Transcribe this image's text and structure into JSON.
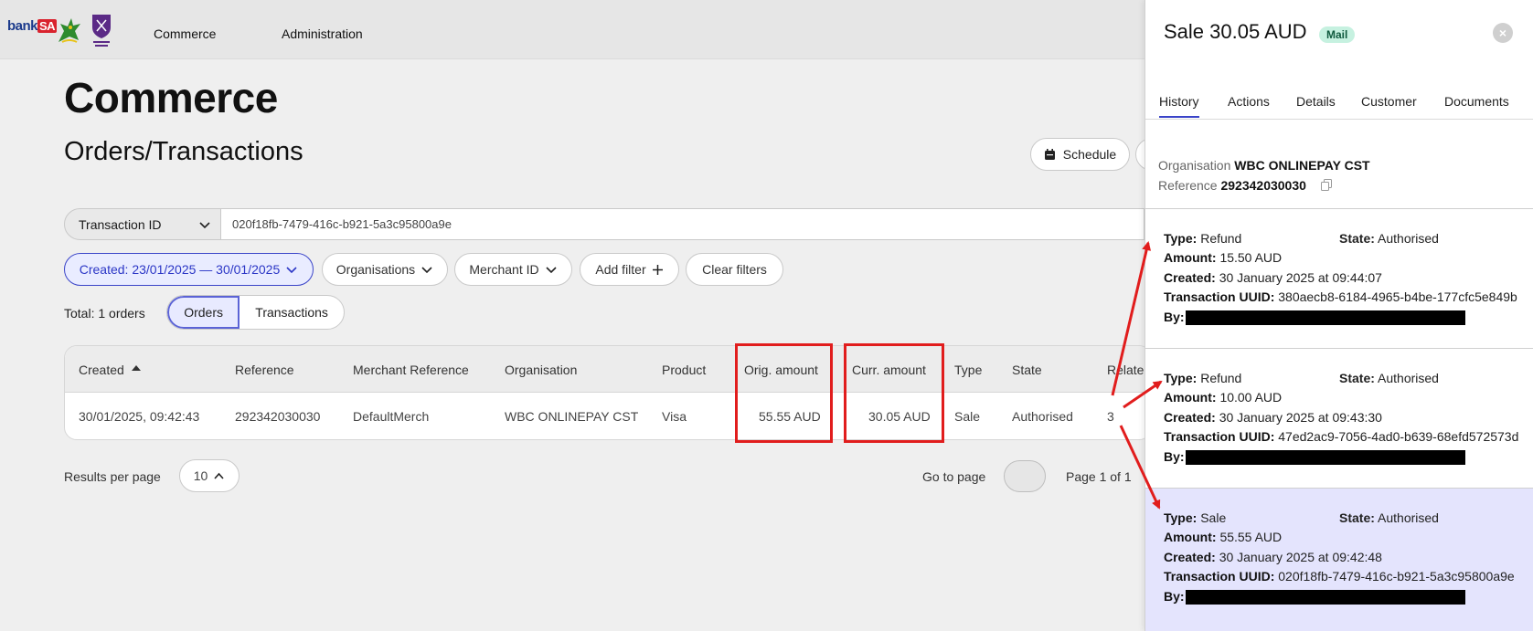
{
  "nav": {
    "logo_text": "bank",
    "logo_text_badge": "SA",
    "items": [
      "Commerce",
      "Administration"
    ]
  },
  "page": {
    "title": "Commerce",
    "subtitle": "Orders/Transactions",
    "schedule_label": "Schedule"
  },
  "search": {
    "field_select": "Transaction ID",
    "value": "020f18fb-7479-416c-b921-5a3c95800a9e"
  },
  "filters": {
    "created": "Created: 23/01/2025 — 30/01/2025",
    "organisations": "Organisations",
    "merchant_id": "Merchant ID",
    "add_filter": "Add filter",
    "clear_filters": "Clear filters"
  },
  "results": {
    "total": "Total: 1 orders",
    "toggle": [
      "Orders",
      "Transactions"
    ]
  },
  "table": {
    "headers": [
      "Created",
      "Reference",
      "Merchant Reference",
      "Organisation",
      "Product",
      "Orig. amount",
      "Curr. amount",
      "Type",
      "State",
      "Related"
    ],
    "rows": [
      [
        "30/01/2025, 09:42:43",
        "292342030030",
        "DefaultMerch",
        "WBC ONLINEPAY CST",
        "Visa",
        "55.55 AUD",
        "30.05 AUD",
        "Sale",
        "Authorised",
        "3"
      ]
    ]
  },
  "pagination": {
    "results_per_page_label": "Results per page",
    "results_per_page": "10",
    "goto_label": "Go to page",
    "page_of": "Page 1 of 1"
  },
  "panel": {
    "title": "Sale 30.05 AUD",
    "badge": "Mail",
    "tabs": [
      "History",
      "Actions",
      "Details",
      "Customer",
      "Documents"
    ],
    "organisation_label": "Organisation",
    "organisation": "WBC ONLINEPAY CST",
    "reference_label": "Reference",
    "reference": "292342030030",
    "labels": {
      "type": "Type:",
      "state": "State:",
      "amount": "Amount:",
      "created": "Created:",
      "uuid": "Transaction UUID:",
      "by": "By:"
    },
    "transactions": [
      {
        "type": "Refund",
        "state": "Authorised",
        "amount": "15.50 AUD",
        "created": "30 January 2025 at 09:44:07",
        "uuid": "380aecb8-6184-4965-b4be-177cfc5e849b"
      },
      {
        "type": "Refund",
        "state": "Authorised",
        "amount": "10.00 AUD",
        "created": "30 January 2025 at 09:43:30",
        "uuid": "47ed2ac9-7056-4ad0-b639-68efd572573d"
      },
      {
        "type": "Sale",
        "state": "Authorised",
        "amount": "55.55 AUD",
        "created": "30 January 2025 at 09:42:48",
        "uuid": "020f18fb-7479-416c-b921-5a3c95800a9e"
      }
    ]
  },
  "colors": {
    "accent": "#3a44c8",
    "annotation_red": "#e11d1d",
    "highlight_row": "#e4e4fd"
  }
}
